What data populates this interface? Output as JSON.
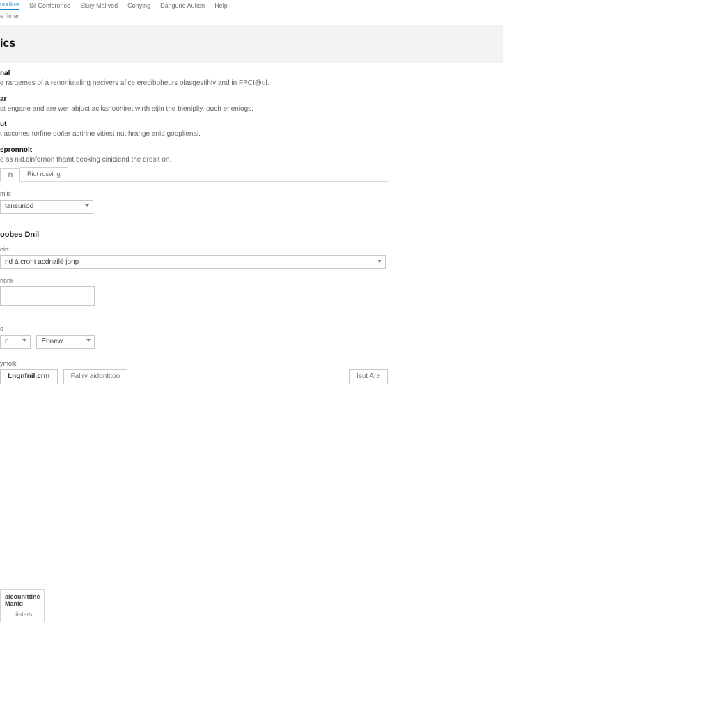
{
  "nav": {
    "items": [
      {
        "label": "nodirer",
        "active": true
      },
      {
        "label": "Sil Conference"
      },
      {
        "label": "Slury Malived"
      },
      {
        "label": "Conying"
      },
      {
        "label": "Dangune Aution"
      },
      {
        "label": "Help"
      }
    ]
  },
  "subbar": {
    "text": "e fimer"
  },
  "title": "ics",
  "sections": [
    {
      "heading": "nal",
      "body": "e rargemes of a renoniuteling necivers afice erediboheurs olasgestihly and in FPCI@ul."
    },
    {
      "heading": "ar",
      "body": "st engane and are wer abjuct acikahoohiret wirth stjin the bienipliy, ouch eneniogs."
    },
    {
      "heading": "ut",
      "body": "t accones torfine doïier actirine vitiest nut hrange anid gooplienal."
    },
    {
      "heading": "spronnolt",
      "body": "e ss nid.cinfornon thamt beoking ciniciend the dresit on."
    }
  ],
  "tabs": {
    "items": [
      {
        "label": "in",
        "active": true
      },
      {
        "label": "Riot rosving"
      }
    ]
  },
  "field1": {
    "label": "mlix",
    "value": "tansuriod"
  },
  "section2": {
    "title": "oobes Dnil"
  },
  "script_field": {
    "label": "oirt",
    "value": "nd á.cront acdnailé jonp"
  },
  "textbox_field": {
    "label": "nonk",
    "value": ""
  },
  "pair_field": {
    "label": "o",
    "left": "n",
    "right": "Eonew"
  },
  "action_row": {
    "label": "ymolk",
    "primary": "t.ngnfnil.crm",
    "secondary": "Faliry aidontiton",
    "tertiary": "Isut Are"
  },
  "floatbox": {
    "line1": "alcounittine",
    "line2": "Manid",
    "line3": "diistars"
  }
}
